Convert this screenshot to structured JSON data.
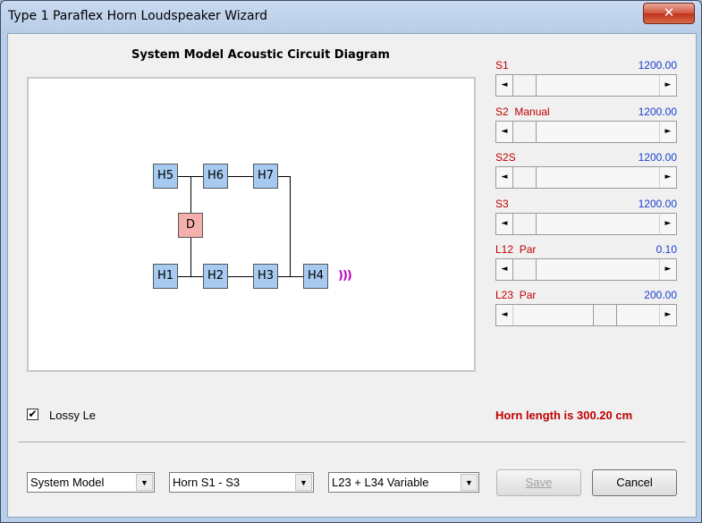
{
  "window": {
    "title": "Type 1 Paraflex Horn Loudspeaker Wizard",
    "close_glyph": "✕"
  },
  "diagram": {
    "title": "System Model Acoustic Circuit Diagram",
    "nodes": {
      "h1": "H1",
      "h2": "H2",
      "h3": "H3",
      "h4": "H4",
      "h5": "H5",
      "h6": "H6",
      "h7": "H7",
      "d": "D"
    },
    "sound_glyph": ")))"
  },
  "sliders": [
    {
      "label": "S1",
      "value": "1200.00",
      "position": 0.0
    },
    {
      "label": "S2  Manual",
      "value": "1200.00",
      "position": 0.0
    },
    {
      "label": "S2S",
      "value": "1200.00",
      "position": 0.0
    },
    {
      "label": "S3",
      "value": "1200.00",
      "position": 0.0
    },
    {
      "label": "L12  Par",
      "value": "0.10",
      "position": 0.0
    },
    {
      "label": "L23  Par",
      "value": "200.00",
      "position": 0.65
    }
  ],
  "lossy": {
    "label": "Lossy Le",
    "checked": true,
    "check_glyph": "✔"
  },
  "horn_length_text": "Horn length is 300.20 cm",
  "combos": {
    "model": "System Model",
    "horn": "Horn S1 - S3",
    "variable": "L23 + L34 Variable",
    "arrow_glyph": "▼"
  },
  "buttons": {
    "save": "Save",
    "cancel": "Cancel"
  },
  "scroll_glyphs": {
    "left": "◄",
    "right": "►"
  },
  "colors": {
    "label_red": "#c00000",
    "value_blue": "#1a3fd0",
    "node_blue": "#a6caf0",
    "node_red": "#f4b0ac",
    "sound_magenta": "#c000c0"
  }
}
